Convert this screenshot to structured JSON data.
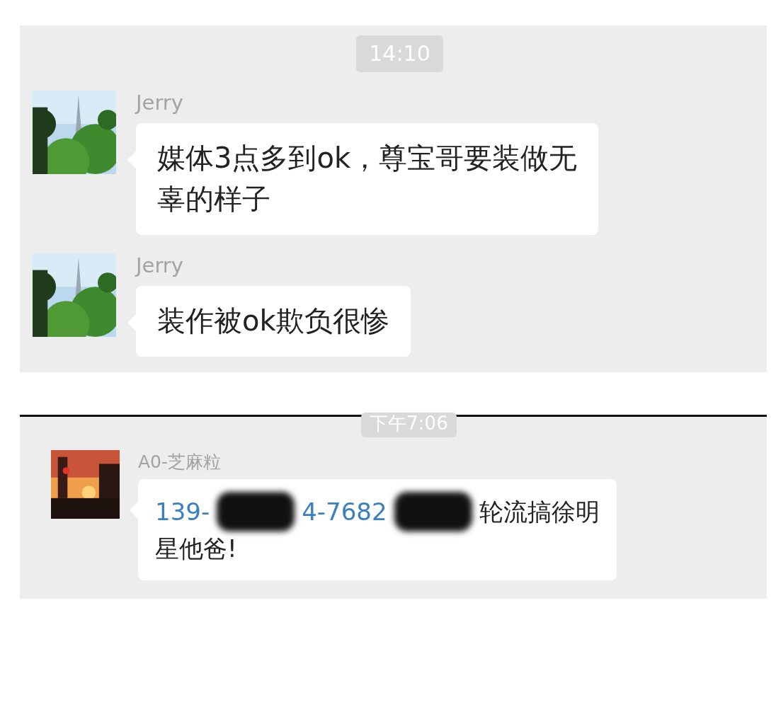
{
  "panels": [
    {
      "time": "14:10",
      "messages": [
        {
          "sender": "Jerry",
          "lines": [
            [
              {
                "kind": "text",
                "text": "媒体3点多到ok，尊宝哥要装做无"
              }
            ],
            [
              {
                "kind": "text",
                "text": "辜的样子"
              }
            ]
          ]
        },
        {
          "sender": "Jerry",
          "lines": [
            [
              {
                "kind": "text",
                "text": "装作被ok欺负很惨"
              }
            ]
          ]
        }
      ]
    },
    {
      "time": "下午7:06",
      "messages": [
        {
          "sender": "A0-芝麻粒",
          "lines": [
            [
              {
                "kind": "link",
                "text": "139-"
              },
              {
                "kind": "redacted"
              },
              {
                "kind": "link",
                "text": "4-7682"
              },
              {
                "kind": "redacted"
              },
              {
                "kind": "text",
                "text": "轮流搞徐明"
              }
            ],
            [
              {
                "kind": "text",
                "text": "星他爸!"
              }
            ]
          ]
        }
      ]
    }
  ]
}
